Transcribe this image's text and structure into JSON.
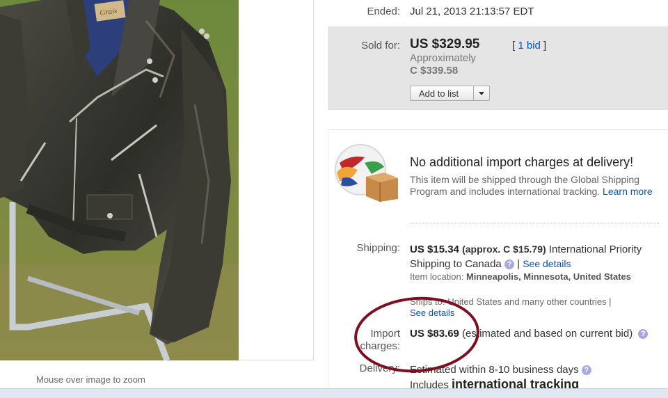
{
  "image": {
    "hint": "Mouse over image to zoom"
  },
  "ended": {
    "label": "Ended:",
    "value": "Jul 21, 2013  21:13:57 EDT"
  },
  "sold": {
    "label": "Sold for:",
    "price": "US $329.95",
    "approx_label": "Approximately",
    "approx_value": "C $339.58",
    "bid_open": "[",
    "bid_link": "1 bid",
    "bid_close": "]",
    "add_to_list": "Add to list"
  },
  "gsp": {
    "title": "No additional import charges at delivery!",
    "body": "This item will be shipped through the Global Shipping Program and includes international tracking.",
    "learn_more": "Learn more"
  },
  "shipping": {
    "label": "Shipping:",
    "cost": "US $15.34",
    "approx": "(approx. C $15.79)",
    "service_line1": "International Priority",
    "service_line2": "Shipping to Canada",
    "see_details": "See details",
    "separator": "|",
    "location_label": "Item location:",
    "location_value": "Minneapolis, Minnesota, United States",
    "ships_to": "Ships to: United States and many other countries |",
    "ships_see_details": "See details"
  },
  "import": {
    "label_line1": "Import",
    "label_line2": "charges:",
    "cost": "US $83.69",
    "note": "(estimated and based on current bid)"
  },
  "delivery": {
    "label": "Delivery:",
    "estimate": "Estimated within 8-10 business days",
    "includes": "Includes",
    "tracking": "international tracking"
  },
  "jacket_label": "Grais",
  "colors": {
    "link": "#0654ba",
    "sold_bg": "#e5e5e5",
    "annotation": "#7a1020"
  },
  "icons": {
    "help": "question-circle-icon",
    "globe": "globe-box-icon",
    "dropdown": "chevron-down-icon"
  }
}
